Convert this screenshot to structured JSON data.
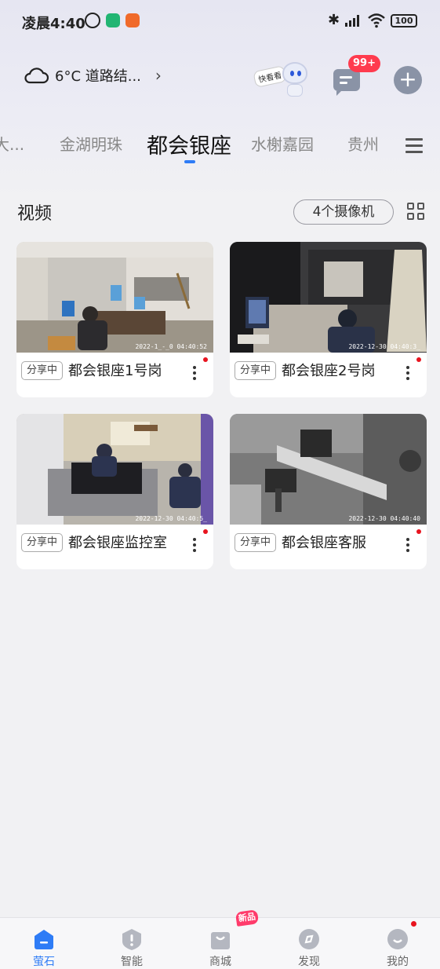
{
  "status_bar": {
    "time": "凌晨4:40",
    "battery": "100"
  },
  "header": {
    "weather": "6°C 道路结...",
    "mascot_tag": "快看看",
    "message_badge": "99+"
  },
  "tabs": [
    {
      "label": "大..."
    },
    {
      "label": "金湖明珠"
    },
    {
      "label": "都会银座",
      "active": true
    },
    {
      "label": "水榭嘉园"
    },
    {
      "label": "贵州"
    }
  ],
  "section": {
    "title": "视频",
    "camera_count": "4个摄像机"
  },
  "cameras": [
    {
      "share": "分享中",
      "name": "都会银座1号岗",
      "timestamp": "2022-1_-_0 04:40:52"
    },
    {
      "share": "分享中",
      "name": "都会银座2号岗",
      "timestamp": "2022-12-30 04:40:3_"
    },
    {
      "share": "分享中",
      "name": "都会银座监控室",
      "timestamp": "2022-12-30 04:40:5_"
    },
    {
      "share": "分享中",
      "name": "都会银座客服",
      "timestamp": "2022-12-30 04:40:40"
    }
  ],
  "bottom_nav": {
    "new_tag": "新品",
    "items": [
      {
        "label": "萤石",
        "active": true
      },
      {
        "label": "智能"
      },
      {
        "label": "商城"
      },
      {
        "label": "发现"
      },
      {
        "label": "我的"
      }
    ]
  },
  "colors": {
    "accent": "#2e7cf6",
    "badge": "#ff3b4e",
    "alert_dot": "#e8141f"
  }
}
